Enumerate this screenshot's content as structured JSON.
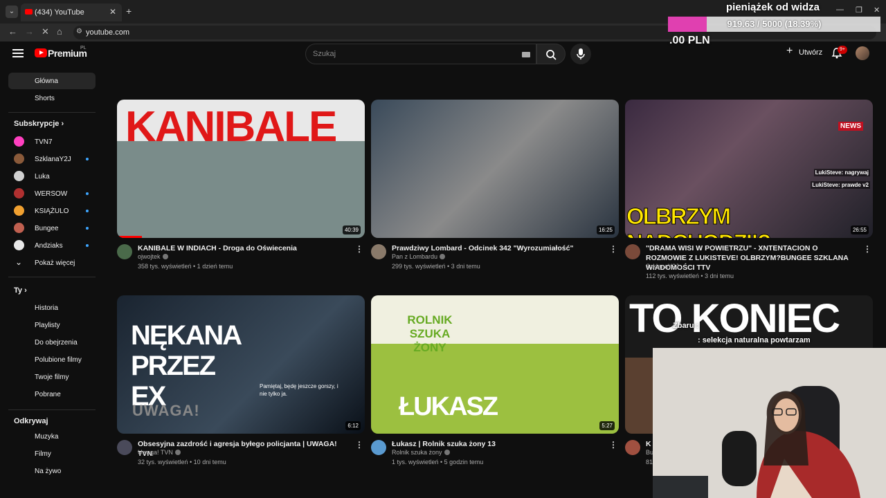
{
  "browser": {
    "tab_title": "(434) YouTube",
    "url": "youtube.com"
  },
  "header": {
    "logo_word": "Premium",
    "logo_country": "PL",
    "search_placeholder": "Szukaj",
    "create_label": "Utwórz",
    "notif_count": "9+"
  },
  "sidebar": {
    "home": "Główna",
    "shorts": "Shorts",
    "subs_title": "Subskrypcje",
    "subs": [
      {
        "label": "TVN7",
        "color": "#ff40c0",
        "dot": false
      },
      {
        "label": "SzklanaY2J",
        "color": "#8a5a3a",
        "dot": true
      },
      {
        "label": "Luka",
        "color": "#d0d0d0",
        "dot": false
      },
      {
        "label": "WERSOW",
        "color": "#b03030",
        "dot": true
      },
      {
        "label": "KSIĄŻULO",
        "color": "#f0a030",
        "dot": true
      },
      {
        "label": "Bungee",
        "color": "#c06050",
        "dot": true
      },
      {
        "label": "Andziaks",
        "color": "#e8e8e8",
        "dot": true
      }
    ],
    "show_more": "Pokaż więcej",
    "you_title": "Ty",
    "you_items": [
      "Historia",
      "Playlisty",
      "Do obejrzenia",
      "Polubione filmy",
      "Twoje filmy",
      "Pobrane"
    ],
    "explore_title": "Odkrywaj",
    "explore_items": [
      "Muzyka",
      "Filmy",
      "Na żywo"
    ]
  },
  "videos": [
    {
      "title": "KANIBALE W INDIACH - Droga do Oświecenia",
      "channel": "ojwojtek",
      "meta": "358 tys. wyświetleń • 1 dzień temu",
      "duration": "40:39",
      "thumb_text": "KANIBALE"
    },
    {
      "title": "Prawdziwy Lombard - Odcinek 342 \"Wyrozumiałość\"",
      "channel": "Pan z Lombardu",
      "meta": "299 tys. wyświetleń • 3 dni temu",
      "duration": "16:25",
      "thumb_text": ""
    },
    {
      "title": "\"DRAMA WISI W POWIETRZU\" - XNTENTACION O ROZMOWIE Z LUKISTEVE! OLBRZYM?BUNGEE SZKLANA WIADOMOŚCI TTV",
      "channel": "SzklanaY2J",
      "meta": "112 tys. wyświetleń • 3 dni temu",
      "duration": "26:55",
      "thumb_text": "OLBRZYM NADCHODZI!?"
    },
    {
      "title": "Obsesyjna zazdrość i agresja byłego policjanta | UWAGA! TVN",
      "channel": "Uwaga! TVN",
      "meta": "32 tys. wyświetleń • 10 dni temu",
      "duration": "6:12",
      "thumb_text": "NĘKANA PRZEZ EX"
    },
    {
      "title": "Łukasz | Rolnik szuka żony 13",
      "channel": "Rolnik szuka żony",
      "meta": "1 tys. wyświetleń • 5 godzin temu",
      "duration": "5:27",
      "thumb_text": "ŁUKASZ"
    },
    {
      "title": "K",
      "channel": "Bu",
      "meta": "81",
      "duration": "",
      "thumb_text": "TO KONIEC"
    }
  ],
  "thumb_extras": {
    "news_badge": "NEWS",
    "chat1": "LukiSteve: nagrywaj",
    "chat2": "LukiSteve: prawde v2",
    "uwaga": "UWAGA!",
    "quote": "Pamiętaj, będę jeszcze gorszy, i nie tylko ja.",
    "rolnik": "ROLNIK SZUKA ŻONY"
  },
  "overlay": {
    "title": "pieniążek od widza",
    "progress_text": "919.63 / 5000 (18.39%)",
    "progress": 0.1839,
    "pln": ".00 PLN",
    "chat_user": "Zbaru :",
    "chat_msg": ": selekcja naturalna powtarzam"
  }
}
